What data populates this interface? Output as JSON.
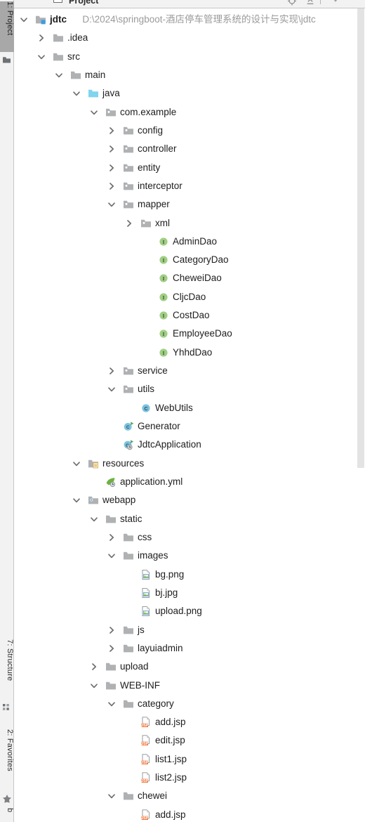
{
  "window": {
    "toolbar_title": "Project",
    "toolbar_icons": [
      "locate-icon",
      "collapse-all-icon",
      "settings-gear-icon"
    ]
  },
  "left_strip": {
    "tabs": [
      {
        "label": "1: Project",
        "icon": "project-tool-icon",
        "active": true
      },
      {
        "label": "7: Structure",
        "icon": "structure-tool-icon",
        "active": false
      },
      {
        "label": "2: Favorites",
        "icon": "favorites-star-icon",
        "active": false
      },
      {
        "label": "b",
        "icon": "",
        "active": false
      }
    ]
  },
  "colors": {
    "source_root_folder": "#7fd4ef",
    "folder_gray": "#afb1b3",
    "interface_green": "#9fcf83",
    "class_blue": "#7cc2e0",
    "jsp_orange": "#f07a3e",
    "run_arrow_green": "#59a869",
    "module_badge_blue": "#3b9ee3",
    "path_text": "#9a9a9a",
    "text": "#1d1d1d",
    "scrollbar_thumb": "#e3e3e3",
    "strip_background": "#f2f2f2",
    "strip_active": "#a8a8a8"
  },
  "tree": {
    "nodes": [
      {
        "label": "jdtc",
        "secondary": "D:\\2024\\springboot-酒店停车管理系统的设计与实现\\jdtc",
        "depth": 0,
        "icon": "module-folder-icon",
        "twisty": "expanded",
        "bold": true
      },
      {
        "label": ".idea",
        "secondary": "",
        "depth": 1,
        "icon": "folder-icon",
        "twisty": "collapsed",
        "bold": false
      },
      {
        "label": "src",
        "secondary": "",
        "depth": 1,
        "icon": "folder-icon",
        "twisty": "expanded",
        "bold": false
      },
      {
        "label": "main",
        "secondary": "",
        "depth": 2,
        "icon": "folder-icon",
        "twisty": "expanded",
        "bold": false
      },
      {
        "label": "java",
        "secondary": "",
        "depth": 3,
        "icon": "source-root-folder-icon",
        "twisty": "expanded",
        "bold": false
      },
      {
        "label": "com.example",
        "secondary": "",
        "depth": 4,
        "icon": "package-icon",
        "twisty": "expanded",
        "bold": false
      },
      {
        "label": "config",
        "secondary": "",
        "depth": 5,
        "icon": "package-icon",
        "twisty": "collapsed",
        "bold": false
      },
      {
        "label": "controller",
        "secondary": "",
        "depth": 5,
        "icon": "package-icon",
        "twisty": "collapsed",
        "bold": false
      },
      {
        "label": "entity",
        "secondary": "",
        "depth": 5,
        "icon": "package-icon",
        "twisty": "collapsed",
        "bold": false
      },
      {
        "label": "interceptor",
        "secondary": "",
        "depth": 5,
        "icon": "package-icon",
        "twisty": "collapsed",
        "bold": false
      },
      {
        "label": "mapper",
        "secondary": "",
        "depth": 5,
        "icon": "package-icon",
        "twisty": "expanded",
        "bold": false
      },
      {
        "label": "xml",
        "secondary": "",
        "depth": 6,
        "icon": "package-icon",
        "twisty": "collapsed",
        "bold": false
      },
      {
        "label": "AdminDao",
        "secondary": "",
        "depth": 7,
        "icon": "interface-icon",
        "twisty": "none",
        "bold": false
      },
      {
        "label": "CategoryDao",
        "secondary": "",
        "depth": 7,
        "icon": "interface-icon",
        "twisty": "none",
        "bold": false
      },
      {
        "label": "CheweiDao",
        "secondary": "",
        "depth": 7,
        "icon": "interface-icon",
        "twisty": "none",
        "bold": false
      },
      {
        "label": "CljcDao",
        "secondary": "",
        "depth": 7,
        "icon": "interface-icon",
        "twisty": "none",
        "bold": false
      },
      {
        "label": "CostDao",
        "secondary": "",
        "depth": 7,
        "icon": "interface-icon",
        "twisty": "none",
        "bold": false
      },
      {
        "label": "EmployeeDao",
        "secondary": "",
        "depth": 7,
        "icon": "interface-icon",
        "twisty": "none",
        "bold": false
      },
      {
        "label": "YhhdDao",
        "secondary": "",
        "depth": 7,
        "icon": "interface-icon",
        "twisty": "none",
        "bold": false
      },
      {
        "label": "service",
        "secondary": "",
        "depth": 5,
        "icon": "package-icon",
        "twisty": "collapsed",
        "bold": false
      },
      {
        "label": "utils",
        "secondary": "",
        "depth": 5,
        "icon": "package-icon",
        "twisty": "expanded",
        "bold": false
      },
      {
        "label": "WebUtils",
        "secondary": "",
        "depth": 6,
        "icon": "class-icon",
        "twisty": "none",
        "bold": false
      },
      {
        "label": "Generator",
        "secondary": "",
        "depth": 5,
        "icon": "class-runnable-icon",
        "twisty": "none",
        "bold": false
      },
      {
        "label": "JdtcApplication",
        "secondary": "",
        "depth": 5,
        "icon": "spring-boot-class-icon",
        "twisty": "none",
        "bold": false
      },
      {
        "label": "resources",
        "secondary": "",
        "depth": 3,
        "icon": "resources-root-icon",
        "twisty": "expanded",
        "bold": false
      },
      {
        "label": "application.yml",
        "secondary": "",
        "depth": 4,
        "icon": "spring-yaml-icon",
        "twisty": "none",
        "bold": false
      },
      {
        "label": "webapp",
        "secondary": "",
        "depth": 3,
        "icon": "webapp-root-icon",
        "twisty": "expanded",
        "bold": false
      },
      {
        "label": "static",
        "secondary": "",
        "depth": 4,
        "icon": "folder-icon",
        "twisty": "expanded",
        "bold": false
      },
      {
        "label": "css",
        "secondary": "",
        "depth": 5,
        "icon": "folder-icon",
        "twisty": "collapsed",
        "bold": false
      },
      {
        "label": "images",
        "secondary": "",
        "depth": 5,
        "icon": "folder-icon",
        "twisty": "expanded",
        "bold": false
      },
      {
        "label": "bg.png",
        "secondary": "",
        "depth": 6,
        "icon": "image-file-icon",
        "twisty": "none",
        "bold": false
      },
      {
        "label": "bj.jpg",
        "secondary": "",
        "depth": 6,
        "icon": "image-file-icon",
        "twisty": "none",
        "bold": false
      },
      {
        "label": "upload.png",
        "secondary": "",
        "depth": 6,
        "icon": "image-file-icon",
        "twisty": "none",
        "bold": false
      },
      {
        "label": "js",
        "secondary": "",
        "depth": 5,
        "icon": "folder-icon",
        "twisty": "collapsed",
        "bold": false
      },
      {
        "label": "layuiadmin",
        "secondary": "",
        "depth": 5,
        "icon": "folder-icon",
        "twisty": "collapsed",
        "bold": false
      },
      {
        "label": "upload",
        "secondary": "",
        "depth": 4,
        "icon": "folder-icon",
        "twisty": "collapsed",
        "bold": false
      },
      {
        "label": "WEB-INF",
        "secondary": "",
        "depth": 4,
        "icon": "folder-icon",
        "twisty": "expanded",
        "bold": false
      },
      {
        "label": "category",
        "secondary": "",
        "depth": 5,
        "icon": "folder-icon",
        "twisty": "expanded",
        "bold": false
      },
      {
        "label": "add.jsp",
        "secondary": "",
        "depth": 6,
        "icon": "jsp-file-icon",
        "twisty": "none",
        "bold": false
      },
      {
        "label": "edit.jsp",
        "secondary": "",
        "depth": 6,
        "icon": "jsp-file-icon",
        "twisty": "none",
        "bold": false
      },
      {
        "label": "list1.jsp",
        "secondary": "",
        "depth": 6,
        "icon": "jsp-file-icon",
        "twisty": "none",
        "bold": false
      },
      {
        "label": "list2.jsp",
        "secondary": "",
        "depth": 6,
        "icon": "jsp-file-icon",
        "twisty": "none",
        "bold": false
      },
      {
        "label": "chewei",
        "secondary": "",
        "depth": 5,
        "icon": "folder-icon",
        "twisty": "expanded",
        "bold": false
      },
      {
        "label": "add.jsp",
        "secondary": "",
        "depth": 6,
        "icon": "jsp-file-icon",
        "twisty": "none",
        "bold": false
      }
    ]
  }
}
